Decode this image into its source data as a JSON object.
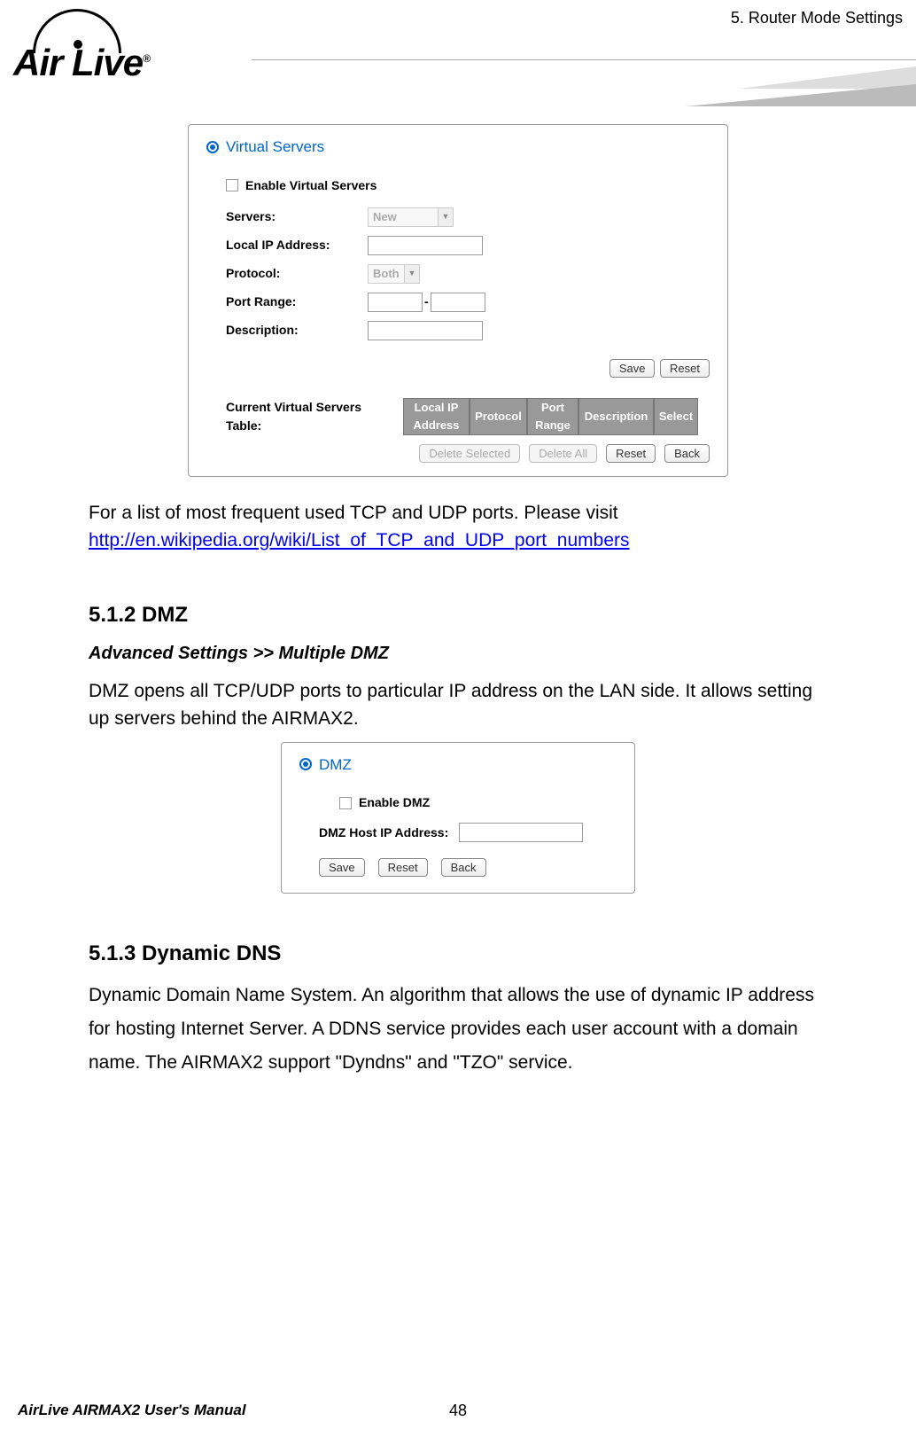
{
  "chapter_header": "5.  Router  Mode  Settings",
  "logo_text": "Air Live",
  "vs_panel": {
    "title": "Virtual Servers",
    "enable_label": "Enable Virtual Servers",
    "labels": {
      "servers": "Servers:",
      "local_ip": "Local IP Address:",
      "protocol": "Protocol:",
      "port_range": "Port Range:",
      "description": "Description:"
    },
    "servers_value": "New",
    "protocol_value": "Both",
    "buttons": {
      "save": "Save",
      "reset": "Reset",
      "delete_selected": "Delete Selected",
      "delete_all": "Delete All",
      "back": "Back"
    },
    "table_label": "Current Virtual Servers Table:",
    "table_headers": [
      "Local IP Address",
      "Protocol",
      "Port Range",
      "Description",
      "Select"
    ]
  },
  "body_text_1": "For a list of most frequent used TCP and UDP ports.    Please visit",
  "link_text": "http://en.wikipedia.org/wiki/List_of_TCP_and_UDP_port_numbers",
  "section_512_heading": "5.1.2 DMZ",
  "section_512_subheading": "Advanced Settings >> Multiple DMZ",
  "section_512_body": "DMZ opens all TCP/UDP ports to particular IP address on the LAN side.    It allows setting up servers behind the AIRMAX2.",
  "dmz_panel": {
    "title": "DMZ",
    "enable_label": "Enable DMZ",
    "host_label": "DMZ Host IP Address:",
    "buttons": {
      "save": "Save",
      "reset": "Reset",
      "back": "Back"
    }
  },
  "section_513_heading": "5.1.3 Dynamic DNS",
  "section_513_body": "Dynamic Domain Name System.    An algorithm that allows the use of dynamic IP address for hosting Internet Server.    A DDNS service provides each user account with a domain name.    The AIRMAX2 support \"Dyndns\" and \"TZO\" service.",
  "footer": {
    "manual": "AirLive AIRMAX2 User's Manual",
    "page": "48"
  }
}
